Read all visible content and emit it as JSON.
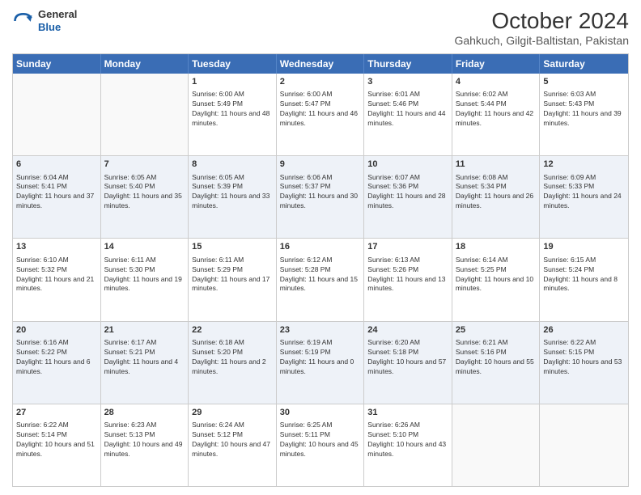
{
  "logo": {
    "general": "General",
    "blue": "Blue"
  },
  "title": "October 2024",
  "subtitle": "Gahkuch, Gilgit-Baltistan, Pakistan",
  "days_of_week": [
    "Sunday",
    "Monday",
    "Tuesday",
    "Wednesday",
    "Thursday",
    "Friday",
    "Saturday"
  ],
  "weeks": [
    [
      {
        "day": "",
        "sunrise": "",
        "sunset": "",
        "daylight": "",
        "empty": true
      },
      {
        "day": "",
        "sunrise": "",
        "sunset": "",
        "daylight": "",
        "empty": true
      },
      {
        "day": "1",
        "sunrise": "Sunrise: 6:00 AM",
        "sunset": "Sunset: 5:49 PM",
        "daylight": "Daylight: 11 hours and 48 minutes."
      },
      {
        "day": "2",
        "sunrise": "Sunrise: 6:00 AM",
        "sunset": "Sunset: 5:47 PM",
        "daylight": "Daylight: 11 hours and 46 minutes."
      },
      {
        "day": "3",
        "sunrise": "Sunrise: 6:01 AM",
        "sunset": "Sunset: 5:46 PM",
        "daylight": "Daylight: 11 hours and 44 minutes."
      },
      {
        "day": "4",
        "sunrise": "Sunrise: 6:02 AM",
        "sunset": "Sunset: 5:44 PM",
        "daylight": "Daylight: 11 hours and 42 minutes."
      },
      {
        "day": "5",
        "sunrise": "Sunrise: 6:03 AM",
        "sunset": "Sunset: 5:43 PM",
        "daylight": "Daylight: 11 hours and 39 minutes."
      }
    ],
    [
      {
        "day": "6",
        "sunrise": "Sunrise: 6:04 AM",
        "sunset": "Sunset: 5:41 PM",
        "daylight": "Daylight: 11 hours and 37 minutes."
      },
      {
        "day": "7",
        "sunrise": "Sunrise: 6:05 AM",
        "sunset": "Sunset: 5:40 PM",
        "daylight": "Daylight: 11 hours and 35 minutes."
      },
      {
        "day": "8",
        "sunrise": "Sunrise: 6:05 AM",
        "sunset": "Sunset: 5:39 PM",
        "daylight": "Daylight: 11 hours and 33 minutes."
      },
      {
        "day": "9",
        "sunrise": "Sunrise: 6:06 AM",
        "sunset": "Sunset: 5:37 PM",
        "daylight": "Daylight: 11 hours and 30 minutes."
      },
      {
        "day": "10",
        "sunrise": "Sunrise: 6:07 AM",
        "sunset": "Sunset: 5:36 PM",
        "daylight": "Daylight: 11 hours and 28 minutes."
      },
      {
        "day": "11",
        "sunrise": "Sunrise: 6:08 AM",
        "sunset": "Sunset: 5:34 PM",
        "daylight": "Daylight: 11 hours and 26 minutes."
      },
      {
        "day": "12",
        "sunrise": "Sunrise: 6:09 AM",
        "sunset": "Sunset: 5:33 PM",
        "daylight": "Daylight: 11 hours and 24 minutes."
      }
    ],
    [
      {
        "day": "13",
        "sunrise": "Sunrise: 6:10 AM",
        "sunset": "Sunset: 5:32 PM",
        "daylight": "Daylight: 11 hours and 21 minutes."
      },
      {
        "day": "14",
        "sunrise": "Sunrise: 6:11 AM",
        "sunset": "Sunset: 5:30 PM",
        "daylight": "Daylight: 11 hours and 19 minutes."
      },
      {
        "day": "15",
        "sunrise": "Sunrise: 6:11 AM",
        "sunset": "Sunset: 5:29 PM",
        "daylight": "Daylight: 11 hours and 17 minutes."
      },
      {
        "day": "16",
        "sunrise": "Sunrise: 6:12 AM",
        "sunset": "Sunset: 5:28 PM",
        "daylight": "Daylight: 11 hours and 15 minutes."
      },
      {
        "day": "17",
        "sunrise": "Sunrise: 6:13 AM",
        "sunset": "Sunset: 5:26 PM",
        "daylight": "Daylight: 11 hours and 13 minutes."
      },
      {
        "day": "18",
        "sunrise": "Sunrise: 6:14 AM",
        "sunset": "Sunset: 5:25 PM",
        "daylight": "Daylight: 11 hours and 10 minutes."
      },
      {
        "day": "19",
        "sunrise": "Sunrise: 6:15 AM",
        "sunset": "Sunset: 5:24 PM",
        "daylight": "Daylight: 11 hours and 8 minutes."
      }
    ],
    [
      {
        "day": "20",
        "sunrise": "Sunrise: 6:16 AM",
        "sunset": "Sunset: 5:22 PM",
        "daylight": "Daylight: 11 hours and 6 minutes."
      },
      {
        "day": "21",
        "sunrise": "Sunrise: 6:17 AM",
        "sunset": "Sunset: 5:21 PM",
        "daylight": "Daylight: 11 hours and 4 minutes."
      },
      {
        "day": "22",
        "sunrise": "Sunrise: 6:18 AM",
        "sunset": "Sunset: 5:20 PM",
        "daylight": "Daylight: 11 hours and 2 minutes."
      },
      {
        "day": "23",
        "sunrise": "Sunrise: 6:19 AM",
        "sunset": "Sunset: 5:19 PM",
        "daylight": "Daylight: 11 hours and 0 minutes."
      },
      {
        "day": "24",
        "sunrise": "Sunrise: 6:20 AM",
        "sunset": "Sunset: 5:18 PM",
        "daylight": "Daylight: 10 hours and 57 minutes."
      },
      {
        "day": "25",
        "sunrise": "Sunrise: 6:21 AM",
        "sunset": "Sunset: 5:16 PM",
        "daylight": "Daylight: 10 hours and 55 minutes."
      },
      {
        "day": "26",
        "sunrise": "Sunrise: 6:22 AM",
        "sunset": "Sunset: 5:15 PM",
        "daylight": "Daylight: 10 hours and 53 minutes."
      }
    ],
    [
      {
        "day": "27",
        "sunrise": "Sunrise: 6:22 AM",
        "sunset": "Sunset: 5:14 PM",
        "daylight": "Daylight: 10 hours and 51 minutes."
      },
      {
        "day": "28",
        "sunrise": "Sunrise: 6:23 AM",
        "sunset": "Sunset: 5:13 PM",
        "daylight": "Daylight: 10 hours and 49 minutes."
      },
      {
        "day": "29",
        "sunrise": "Sunrise: 6:24 AM",
        "sunset": "Sunset: 5:12 PM",
        "daylight": "Daylight: 10 hours and 47 minutes."
      },
      {
        "day": "30",
        "sunrise": "Sunrise: 6:25 AM",
        "sunset": "Sunset: 5:11 PM",
        "daylight": "Daylight: 10 hours and 45 minutes."
      },
      {
        "day": "31",
        "sunrise": "Sunrise: 6:26 AM",
        "sunset": "Sunset: 5:10 PM",
        "daylight": "Daylight: 10 hours and 43 minutes."
      },
      {
        "day": "",
        "sunrise": "",
        "sunset": "",
        "daylight": "",
        "empty": true
      },
      {
        "day": "",
        "sunrise": "",
        "sunset": "",
        "daylight": "",
        "empty": true
      }
    ]
  ]
}
